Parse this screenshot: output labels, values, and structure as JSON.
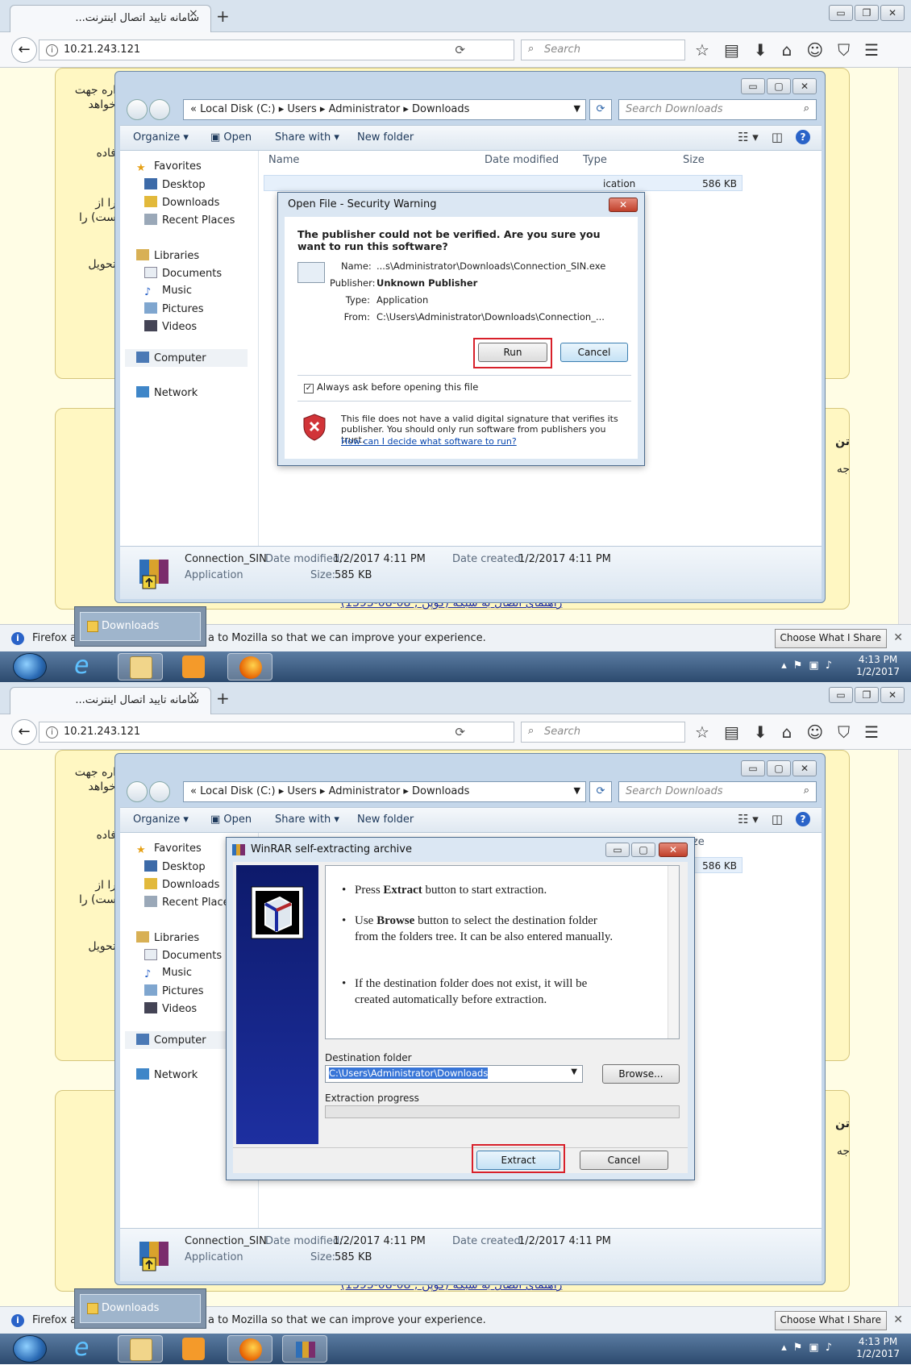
{
  "browser": {
    "tab_title": "سامانه تایید اتصال اینترنت...",
    "tab_close": "×",
    "new_tab": "+",
    "url": "10.21.243.121",
    "search_placeholder": "Search",
    "notification_left": "Firefox au",
    "notification_text": "a to Mozilla so that we can improve your experience.",
    "choose_button": "Choose What I Share",
    "downloads_popup": "Downloads"
  },
  "page": {
    "snippet_1a": "اره جهت",
    "snippet_1b": "خواهد",
    "snippet_2": "فاده",
    "snippet_3a": "را از",
    "snippet_3b": "ست) را",
    "snippet_4": "تحویل",
    "snippet_5": "تن",
    "snippet_6": "جه",
    "link_text": "(1395-08-08 ; راهنمای اتصال به شبکه (کوپن"
  },
  "explorer": {
    "breadcrumb": [
      "«",
      "Local Disk (C:)",
      "Users",
      "Administrator",
      "Downloads"
    ],
    "search_placeholder": "Search Downloads",
    "toolbar": {
      "organize": "Organize ▾",
      "open": "Open",
      "share_with": "Share with ▾",
      "new_folder": "New folder"
    },
    "nav": {
      "favorites": "Favorites",
      "desktop": "Desktop",
      "downloads": "Downloads",
      "recent_places": "Recent Places",
      "recent_places_cut": "Recent Place",
      "libraries": "Libraries",
      "documents": "Documents",
      "music": "Music",
      "pictures": "Pictures",
      "videos": "Videos",
      "computer": "Computer",
      "network": "Network"
    },
    "columns": {
      "name": "Name",
      "date_modified": "Date modified",
      "type": "Type",
      "size": "Size"
    },
    "file_row": {
      "type_cut": "ication",
      "size": "586 KB"
    },
    "details": {
      "file_name": "Connection_SIN",
      "date_modified_label": "Date modified:",
      "date_modified": "1/2/2017 4:11 PM",
      "date_created_label": "Date created:",
      "date_created": "1/2/2017 4:11 PM",
      "file_type": "Application",
      "size_label": "Size:",
      "size": "585 KB"
    }
  },
  "security_dialog": {
    "title": "Open File - Security Warning",
    "headline": "The publisher could not be verified.  Are you sure you want to run this software?",
    "name_label": "Name:",
    "name_value": "...s\\Administrator\\Downloads\\Connection_SIN.exe",
    "publisher_label": "Publisher:",
    "publisher_value": "Unknown Publisher",
    "type_label": "Type:",
    "type_value": "Application",
    "from_label": "From:",
    "from_value": "C:\\Users\\Administrator\\Downloads\\Connection_...",
    "run_button": "Run",
    "cancel_button": "Cancel",
    "always_ask": "Always ask before opening this file",
    "warning_text": "This file does not have a valid digital signature that verifies its publisher.  You should only run software from publishers you trust.",
    "help_link": "How can I decide what software to run?"
  },
  "winrar_dialog": {
    "title": "WinRAR self-extracting archive",
    "bullet_1_pre": "Press ",
    "bullet_1_bold": "Extract",
    "bullet_1_post": " button to start extraction.",
    "bullet_2_pre": "Use ",
    "bullet_2_bold": "Browse",
    "bullet_2_post": " button to select the destination folder from the folders tree. It can be also entered manually.",
    "bullet_3": "If the destination folder does not exist, it will be created automatically before extraction.",
    "destination_label": "Destination folder",
    "destination_value": "C:\\Users\\Administrator\\Downloads",
    "browse_button": "Browse...",
    "progress_label": "Extraction progress",
    "progress": 0,
    "extract_button": "Extract",
    "cancel_button": "Cancel"
  },
  "taskbar": {
    "time": "4:13 PM",
    "date": "1/2/2017"
  },
  "colors": {
    "highlight": "#d8202a",
    "page_background": "#fffde5",
    "taskbar": "#3b5b80"
  }
}
